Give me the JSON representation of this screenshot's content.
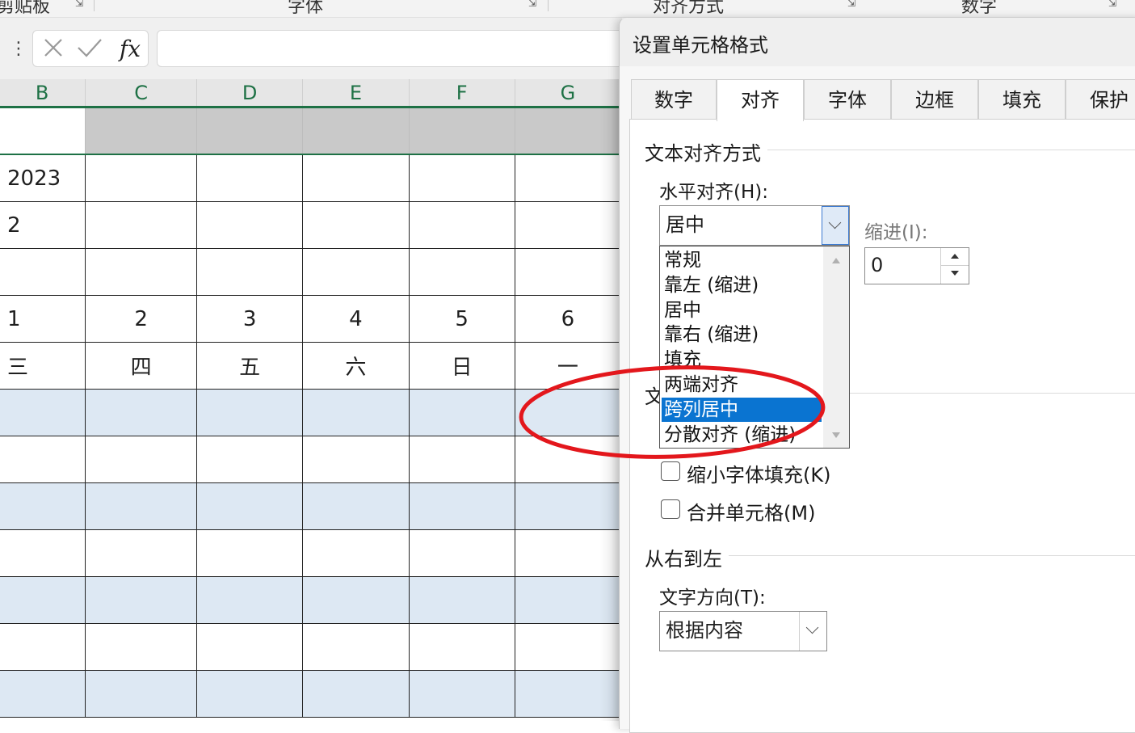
{
  "ribbon": {
    "groups": [
      "剪贴板",
      "字体",
      "对齐方式",
      "数字"
    ]
  },
  "formula_bar": {
    "more_icon": "vertical-ellipsis-icon",
    "cancel_icon": "x-icon",
    "enter_icon": "check-icon",
    "fx_label": "fx",
    "value": ""
  },
  "sheet": {
    "columns": [
      "B",
      "C",
      "D",
      "E",
      "F",
      "G"
    ],
    "rows": [
      [
        "2023",
        "",
        "",
        "",
        "",
        ""
      ],
      [
        "2",
        "",
        "",
        "",
        "",
        ""
      ],
      [
        "",
        "",
        "",
        "",
        "",
        ""
      ],
      [
        "1",
        "2",
        "3",
        "4",
        "5",
        "6"
      ],
      [
        "三",
        "四",
        "五",
        "六",
        "日",
        "一"
      ],
      [
        "",
        "",
        "",
        "",
        "",
        ""
      ],
      [
        "",
        "",
        "",
        "",
        "",
        ""
      ],
      [
        "",
        "",
        "",
        "",
        "",
        ""
      ],
      [
        "",
        "",
        "",
        "",
        "",
        ""
      ],
      [
        "",
        "",
        "",
        "",
        "",
        ""
      ],
      [
        "",
        "",
        "",
        "",
        "",
        ""
      ],
      [
        "",
        "",
        "",
        "",
        "",
        ""
      ]
    ],
    "band_color": "#dde8f3",
    "header_fill": "#c9c9c9",
    "accent": "#1e7145"
  },
  "dialog": {
    "title": "设置单元格格式",
    "tabs": [
      "数字",
      "对齐",
      "字体",
      "边框",
      "填充",
      "保护"
    ],
    "active_tab": "对齐",
    "text_alignment_title": "文本对齐方式",
    "horizontal_label": "水平对齐(H):",
    "horizontal_value": "居中",
    "indent_label": "缩进(I):",
    "indent_value": "0",
    "horizontal_options": [
      "常规",
      "靠左 (缩进)",
      "居中",
      "靠右 (缩进)",
      "填充",
      "两端对齐",
      "跨列居中",
      "分散对齐 (缩进)"
    ],
    "selected_option": "跨列居中",
    "text_control_title_partial": "文",
    "shrink_label": "缩小字体填充(K)",
    "merge_label": "合并单元格(M)",
    "rtl_title": "从右到左",
    "direction_label": "文字方向(T):",
    "direction_value": "根据内容",
    "selection_color": "#0a74d1",
    "annotation_color": "#e3171c"
  }
}
